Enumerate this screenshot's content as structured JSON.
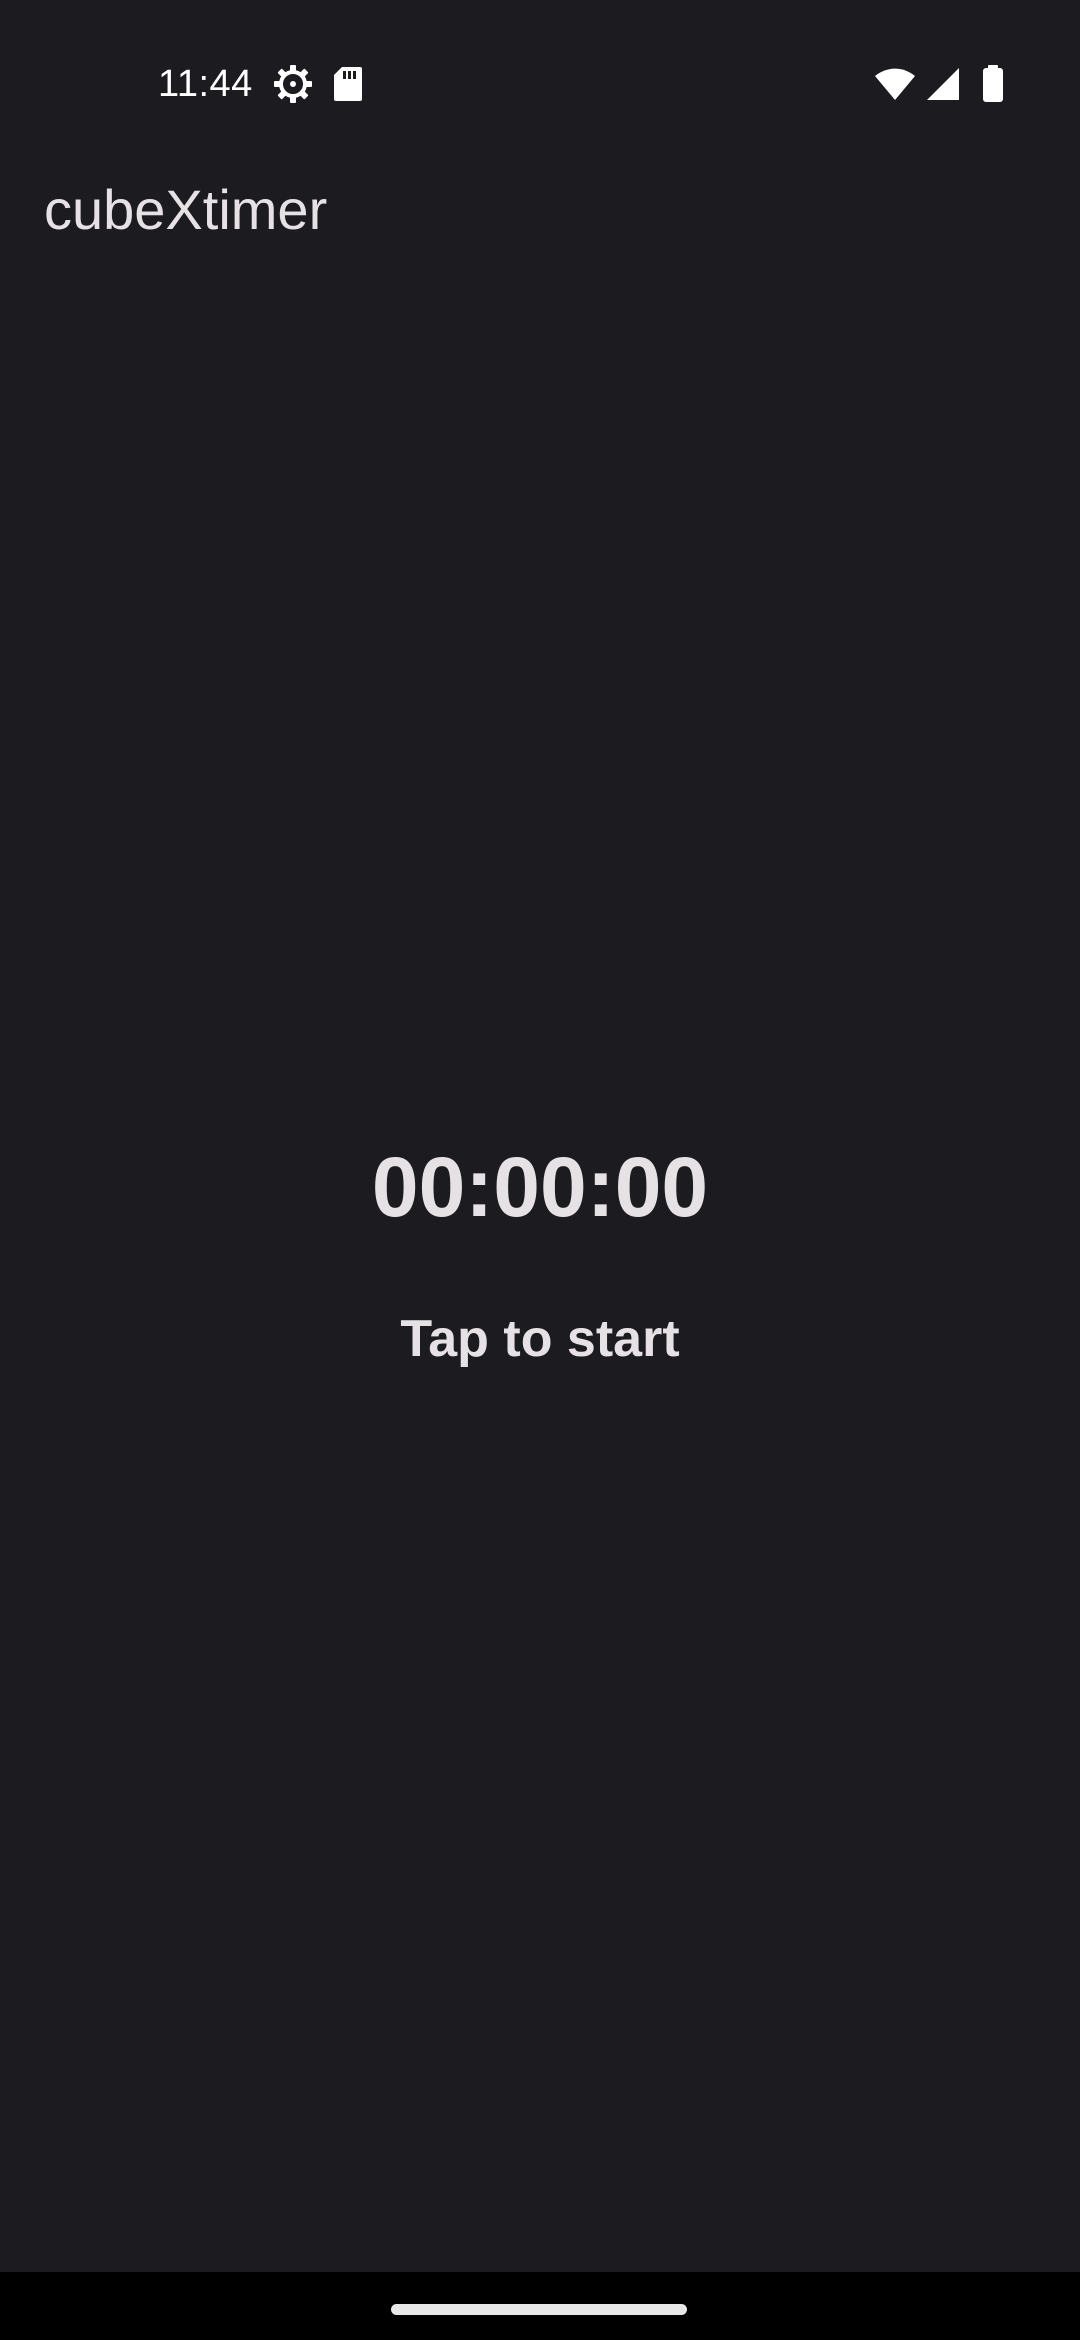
{
  "status_bar": {
    "time": "11:44",
    "icons_left": [
      "settings-gear-icon",
      "sd-card-icon"
    ],
    "icons_right": [
      "wifi-icon",
      "cell-signal-icon",
      "battery-icon"
    ]
  },
  "app_bar": {
    "title": "cubeXtimer"
  },
  "timer": {
    "value": "00:00:00",
    "hint": "Tap to start"
  },
  "colors": {
    "background": "#1c1b20",
    "text": "#e6e1e5",
    "nav_bar": "#000000"
  }
}
